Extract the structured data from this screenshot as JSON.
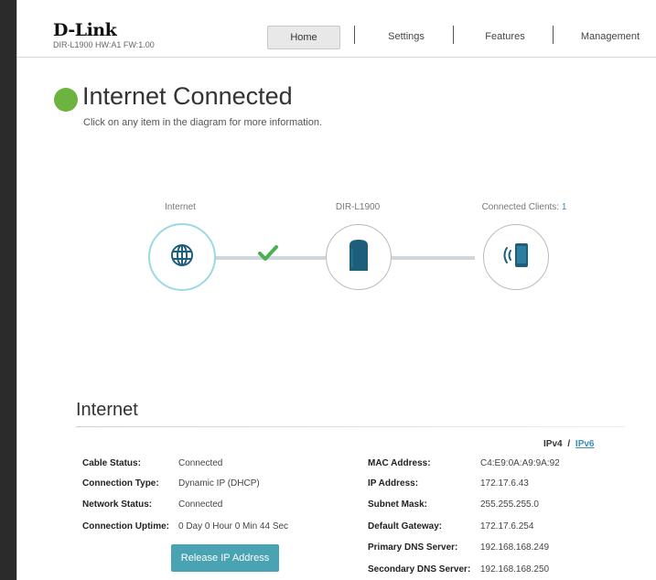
{
  "brand": {
    "logo": "D-Link",
    "model": "DIR-L1900 HW:A1 FW:1.00"
  },
  "nav": {
    "home": "Home",
    "settings": "Settings",
    "features": "Features",
    "management": "Management"
  },
  "status": {
    "title": "Internet Connected",
    "subtitle": "Click on any item in the diagram for more information.",
    "color": "#6cb33f"
  },
  "diagram": {
    "internet_label": "Internet",
    "router_label": "DIR-L1900",
    "clients_label": "Connected Clients: ",
    "clients_count": "1"
  },
  "internet": {
    "section_title": "Internet",
    "ipv4": "IPv4",
    "slash": "/",
    "ipv6": "IPv6",
    "left": [
      {
        "label": "Cable Status:",
        "value": "Connected"
      },
      {
        "label": "Connection Type:",
        "value": "Dynamic IP (DHCP)"
      },
      {
        "label": "Network Status:",
        "value": "Connected"
      },
      {
        "label": "Connection Uptime:",
        "value": "0 Day 0 Hour 0 Min 44 Sec"
      }
    ],
    "right": [
      {
        "label": "MAC Address:",
        "value": "C4:E9:0A:A9:9A:92"
      },
      {
        "label": "IP Address:",
        "value": "172.17.6.43"
      },
      {
        "label": "Subnet Mask:",
        "value": "255.255.255.0"
      },
      {
        "label": "Default Gateway:",
        "value": "172.17.6.254"
      },
      {
        "label": "Primary DNS Server:",
        "value": "192.168.168.249"
      },
      {
        "label": "Secondary DNS Server:",
        "value": "192.168.168.250"
      }
    ],
    "release_button": "Release IP Address"
  }
}
